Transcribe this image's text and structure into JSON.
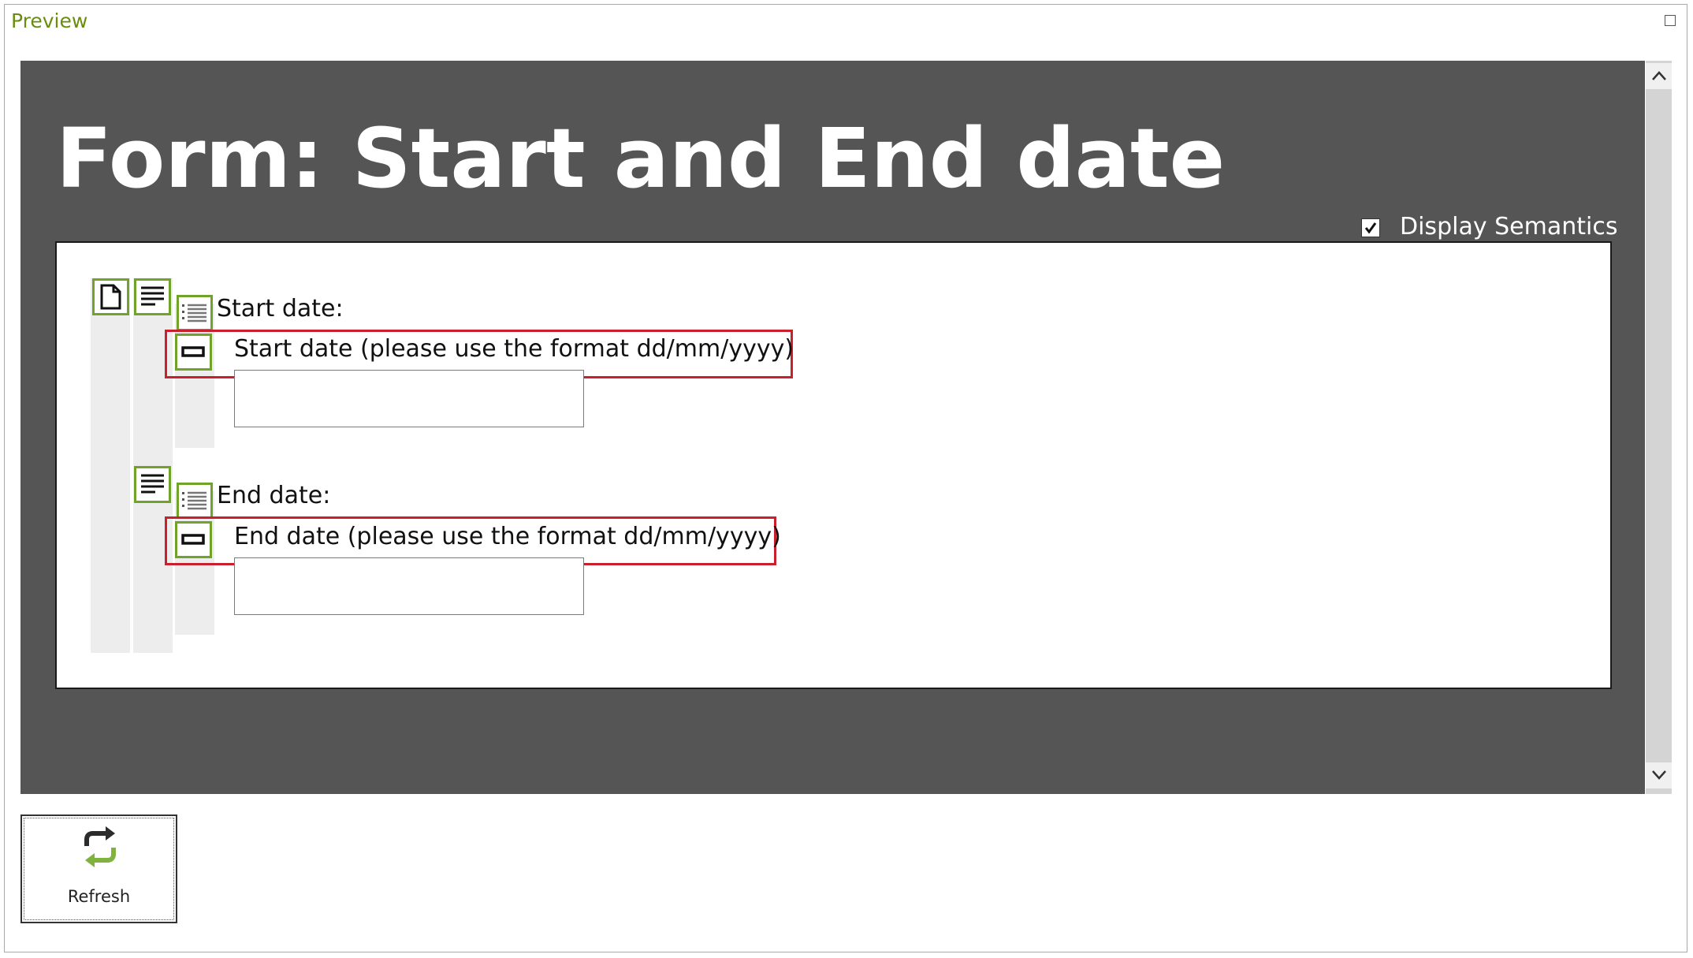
{
  "panel": {
    "title": "Preview"
  },
  "form": {
    "title": "Form: Start and End date",
    "display_semantics": {
      "label": "Display Semantics",
      "checked": true
    },
    "fields": [
      {
        "label": "Start date:",
        "input_label": "Start date (please use the format dd/mm/yyyy)",
        "value": ""
      },
      {
        "label": "End date:",
        "input_label": "End date (please use the format dd/mm/yyyy)",
        "value": ""
      }
    ]
  },
  "toolbar": {
    "refresh_label": "Refresh"
  },
  "colors": {
    "semantic_icon_border": "#71a22a",
    "highlight": "#c8202c",
    "preview_background": "#555555",
    "panel_title": "#6a8d0f"
  },
  "icons": {
    "document": "document-icon",
    "paragraph": "paragraph-icon",
    "list": "list-icon",
    "input": "input-field-icon",
    "refresh": "refresh-icon"
  }
}
